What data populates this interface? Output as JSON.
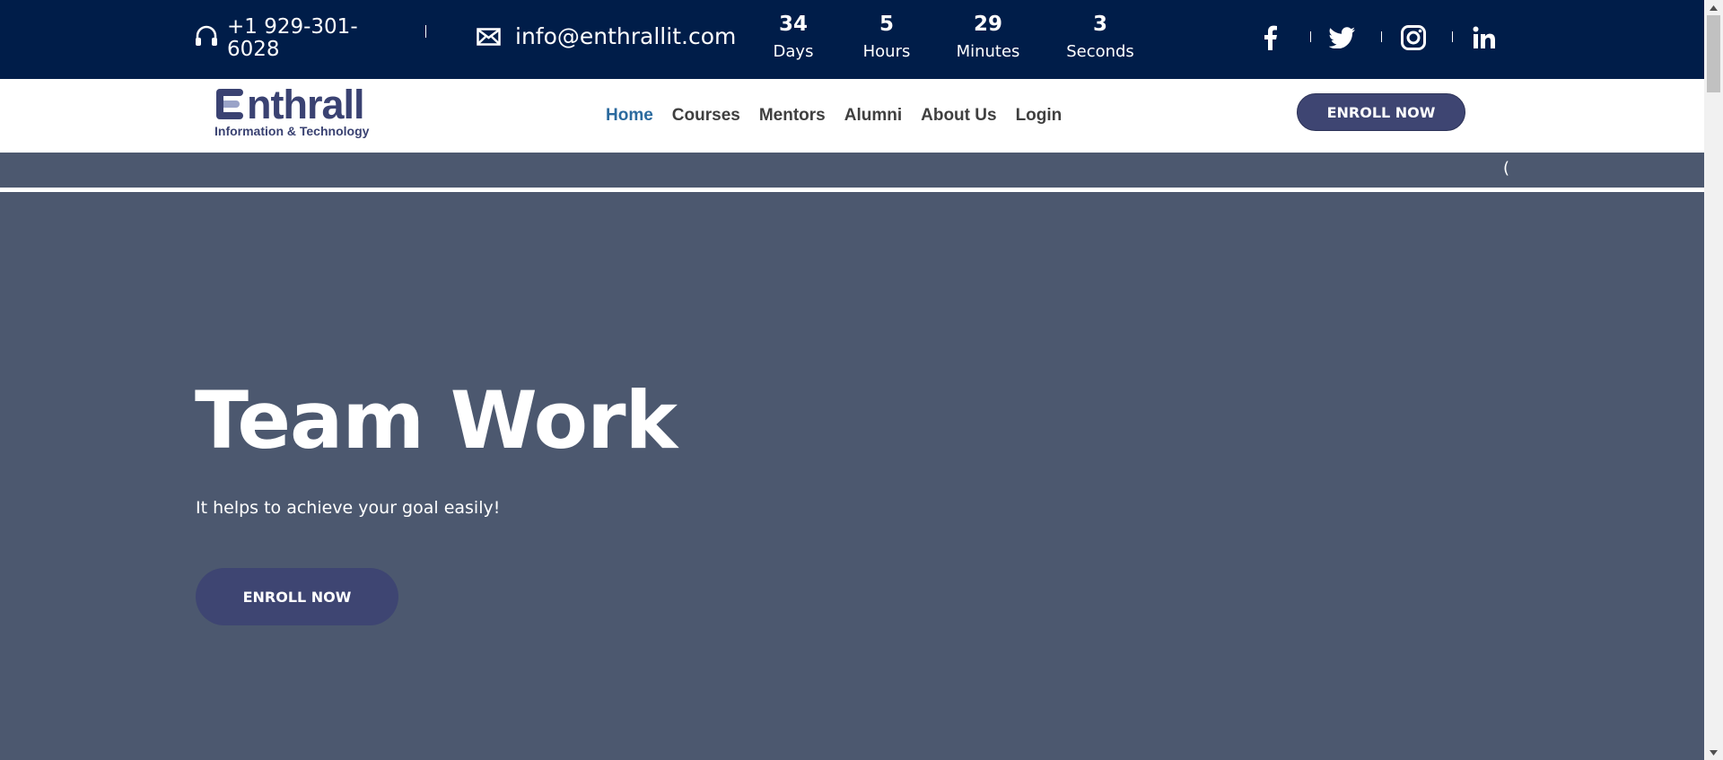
{
  "topbar": {
    "phone": "+1 929-301-6028",
    "email": "info@enthrallit.com",
    "countdown": [
      {
        "value": "34",
        "label": "Days"
      },
      {
        "value": "5",
        "label": "Hours"
      },
      {
        "value": "29",
        "label": "Minutes"
      },
      {
        "value": "3",
        "label": "Seconds"
      }
    ],
    "social": [
      "facebook-icon",
      "twitter-icon",
      "instagram-icon",
      "linkedin-icon"
    ]
  },
  "header": {
    "logo_word": "nthrall",
    "logo_tagline": "Information & Technology",
    "nav": [
      {
        "label": "Home",
        "active": true
      },
      {
        "label": "Courses"
      },
      {
        "label": "Mentors"
      },
      {
        "label": "Alumni"
      },
      {
        "label": "About Us"
      },
      {
        "label": "Login"
      }
    ],
    "enroll_label": "ENROLL NOW"
  },
  "strip": {
    "glyph": "("
  },
  "hero": {
    "title": "Team Work",
    "subtitle": "It helps to achieve your goal easily!",
    "enroll_label": "ENROLL NOW"
  },
  "colors": {
    "topbar_bg": "#001d49",
    "hero_bg": "#4c586f",
    "button_bg": "#3e4572",
    "nav_active": "#2b6a9e"
  }
}
